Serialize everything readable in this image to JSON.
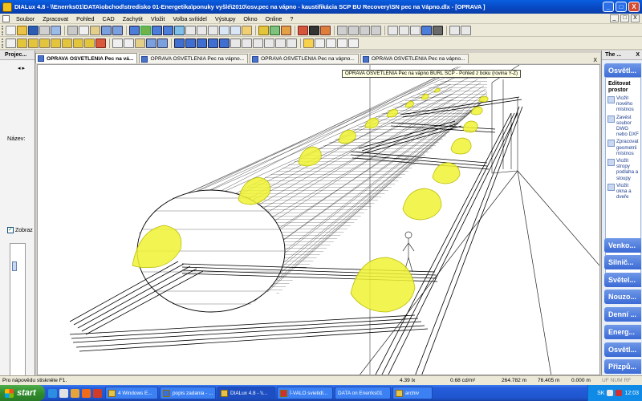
{
  "window": {
    "title": "DIALux 4.8 - \\\\Enerrks01\\DATA\\obchod\\stredisko 01-Energetika\\ponuky vyšlé\\2010\\osv.pec na vápno - kaustifikácia SCP BU Recovery\\SN pec na Vápno.dlx - [OPRAVA ]",
    "controls": [
      "_",
      "□",
      "X"
    ]
  },
  "menu": {
    "items": [
      "Soubor",
      "Zpracovat",
      "Pohled",
      "CAD",
      "Zachytit",
      "Vložit",
      "Volba svítidel",
      "Výstupy",
      "Okno",
      "Online",
      "?"
    ],
    "doc_controls": [
      "_",
      "□",
      "X"
    ]
  },
  "left_panel": {
    "title": "Projec...",
    "nav_arrows": "◂ ▸",
    "name_label": "Název:",
    "checkbox_label": "Zobraz",
    "checkbox_checked": "✓"
  },
  "tabs": [
    {
      "label": "OPRAVA OSVETLENIA Pec na vá..."
    },
    {
      "label": "OPRAVA OSVETLENIA Pec na vápno..."
    },
    {
      "label": "OPRAVA OSVETLENIA Pec na vápno..."
    },
    {
      "label": "OPRAVA OSVETLENIA Pec na vápno..."
    }
  ],
  "tabs_close": "X",
  "viewport": {
    "tooltip": "OPRAVA OSVETLENIA Pec na vápno BURL SCP - Pohled z boku (rovina Y-Z)"
  },
  "right_panel": {
    "title": "The ...",
    "close": "X",
    "section_top": "Osvětl...",
    "box_header": "Editovat prostor",
    "items": [
      "Vložit nového místnos",
      "Zavést soubor DWG nebo DXF",
      "Zpracovat geometrii místnos",
      "Vložit stropy podlaha a sloupy",
      "Vložit okna a dveře"
    ],
    "sections": [
      "Venko...",
      "Silnič...",
      "Světel...",
      "Nouzo...",
      "Denní ...",
      "Energ...",
      "Osvětl...",
      "Přizpů..."
    ]
  },
  "status": {
    "hint": "Pro nápovědu stiskněte F1.",
    "lux": "4.39 lx",
    "area": "0.68 cd/m²",
    "x": "264.782 m",
    "y": "76.405 m",
    "z": "0.000 m",
    "flags": "UF  NUM  RF"
  },
  "taskbar": {
    "start": "start",
    "tasks": [
      {
        "label": "4 Windows E..."
      },
      {
        "label": "popis zadania - ..."
      },
      {
        "label": "DIALux 4.8 - \\\\..."
      },
      {
        "label": "Í-VALO svietidl..."
      },
      {
        "label": "DATA on Enerrks01"
      },
      {
        "label": "archiv"
      }
    ],
    "clock": "12:03",
    "lang": "SK"
  },
  "colors": {
    "title_bar": "#0846c0",
    "luminaire_yellow": "#eef232",
    "taskbar_blue": "#245edb",
    "start_green": "#3c9a3a",
    "panel_blue": "#3b6ad6"
  }
}
